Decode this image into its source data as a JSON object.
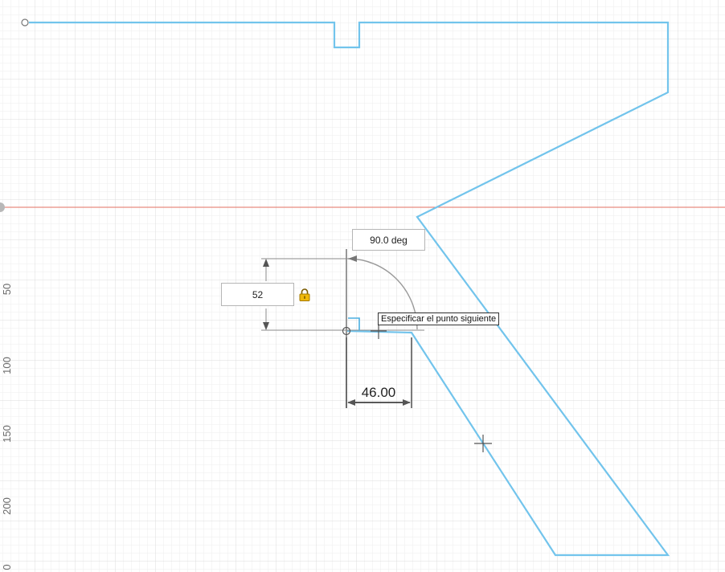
{
  "rulers": {
    "vertical_labels": [
      "50",
      "100",
      "150",
      "200",
      "0"
    ]
  },
  "dimensions": {
    "angle_value": "90.0 deg",
    "length_value": "52",
    "horizontal_value": "46.00"
  },
  "tooltip": {
    "text": "Especificar el punto siguiente"
  },
  "colors": {
    "sketch_line": "#72c4ec",
    "axis_line": "#e06a5a",
    "grid_minor": "#ececec",
    "grid_major": "#dadada",
    "dimension_line": "#8a8a8a",
    "lock": "#e8b30a"
  },
  "icons": [
    "lock-icon",
    "origin-marker-icon",
    "crosshair-icon"
  ]
}
